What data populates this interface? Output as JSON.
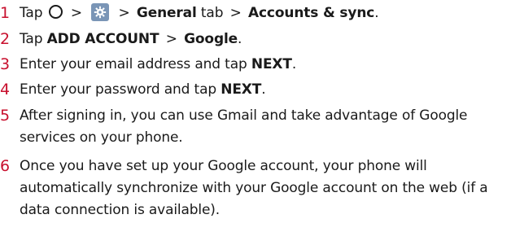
{
  "steps": [
    {
      "number": "1",
      "tap": "Tap",
      "sep1": ">",
      "sep2": ">",
      "general": "General",
      "tab": "tab",
      "sep3": ">",
      "accounts_sync": "Accounts & sync",
      "end": ".",
      "home_icon": "circle-home-icon",
      "settings_icon": "gear-icon"
    },
    {
      "number": "2",
      "tap": "Tap",
      "add_account": "ADD ACCOUNT",
      "sep": ">",
      "google": "Google",
      "end": "."
    },
    {
      "number": "3",
      "text": "Enter your email address and tap",
      "next": "NEXT",
      "end": "."
    },
    {
      "number": "4",
      "text": "Enter your password and tap",
      "next": "NEXT",
      "end": "."
    },
    {
      "number": "5",
      "line1": "After signing in, you can use Gmail and take advantage of Google",
      "line2": "services on your phone."
    },
    {
      "number": "6",
      "line1": "Once you have set up your Google account, your phone will",
      "line2": "automatically synchronize with your Google account on the web (if a",
      "line3": "data connection is available)."
    }
  ],
  "colors": {
    "step_number": "#c8102e",
    "text": "#1a1a1a",
    "settings_icon_bg": "#7a95b6"
  }
}
